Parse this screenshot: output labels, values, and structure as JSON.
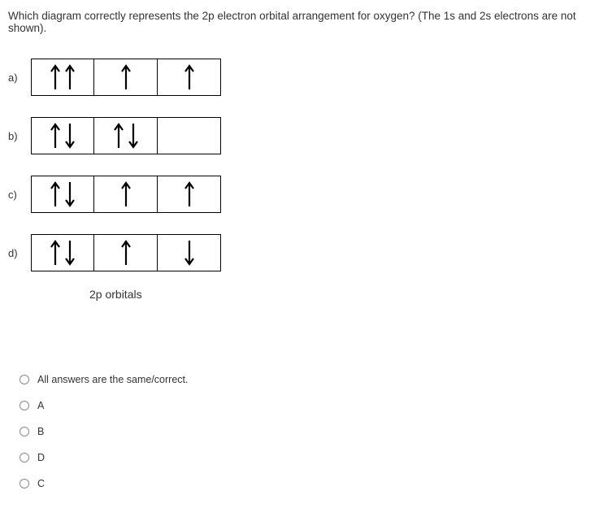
{
  "question": "Which diagram correctly represents the 2p electron orbital arrangement for oxygen? (The 1s and 2s electrons are not shown).",
  "diagrams": {
    "a": {
      "label": "a)",
      "boxes": [
        [
          "up",
          "up"
        ],
        [
          "up"
        ],
        [
          "up"
        ]
      ]
    },
    "b": {
      "label": "b)",
      "boxes": [
        [
          "up",
          "down"
        ],
        [
          "up",
          "down"
        ],
        []
      ]
    },
    "c": {
      "label": "c)",
      "boxes": [
        [
          "up",
          "down"
        ],
        [
          "up"
        ],
        [
          "up"
        ]
      ]
    },
    "d": {
      "label": "d)",
      "boxes": [
        [
          "up",
          "down"
        ],
        [
          "up"
        ],
        [
          "down"
        ]
      ]
    }
  },
  "caption": "2p orbitals",
  "options": {
    "all": "All answers are the same/correct.",
    "a": "A",
    "b": "B",
    "d": "D",
    "c": "C"
  }
}
